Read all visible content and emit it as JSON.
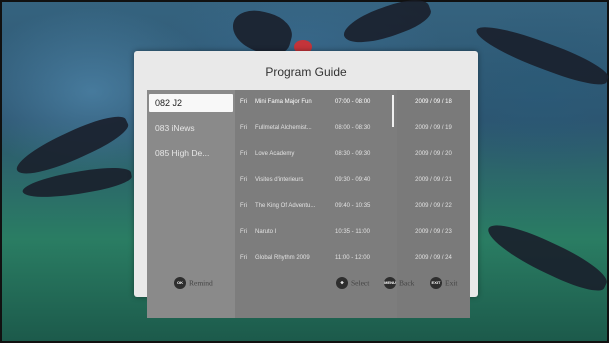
{
  "dialog": {
    "title": "Program Guide"
  },
  "channels": [
    {
      "label": "082  J2",
      "selected": true
    },
    {
      "label": "083  iNews",
      "selected": false
    },
    {
      "label": "085  High De...",
      "selected": false
    }
  ],
  "programs": [
    {
      "day": "Fri",
      "name": "Mini Fama Major Fun",
      "time": "07:00 - 08:00",
      "date": "2009 / 09 / 18"
    },
    {
      "day": "Fri",
      "name": "Fullmetal Alchemist...",
      "time": "08:00 - 08:30",
      "date": "2009 / 09 / 19"
    },
    {
      "day": "Fri",
      "name": "Love Academy",
      "time": "08:30 - 09:30",
      "date": "2009 / 09 / 20"
    },
    {
      "day": "Fri",
      "name": "Visites d'interieurs",
      "time": "09:30 - 09:40",
      "date": "2009 / 09 / 21"
    },
    {
      "day": "Fri",
      "name": "The King Of Adventu...",
      "time": "09:40 - 10:35",
      "date": "2009 / 09 / 22"
    },
    {
      "day": "Fri",
      "name": "Naruto I",
      "time": "10:35 - 11:00",
      "date": "2009 / 09 / 23"
    },
    {
      "day": "Fri",
      "name": "Global Rhythm 2009",
      "time": "11:00 - 12:00",
      "date": "2009 / 09 / 24"
    }
  ],
  "footer": {
    "remind": {
      "button": "OK",
      "label": "Remind"
    },
    "select": {
      "button": "",
      "label": "Select"
    },
    "back": {
      "button": "MENU",
      "label": "Back"
    },
    "exit": {
      "button": "EXIT",
      "label": "Exit"
    }
  },
  "colors": {
    "dialog_bg": "#e9e9e9",
    "panel_bg": "#7d7d7d",
    "selected_bg": "#f8f8f8",
    "button_bg": "#2e2e2e"
  }
}
